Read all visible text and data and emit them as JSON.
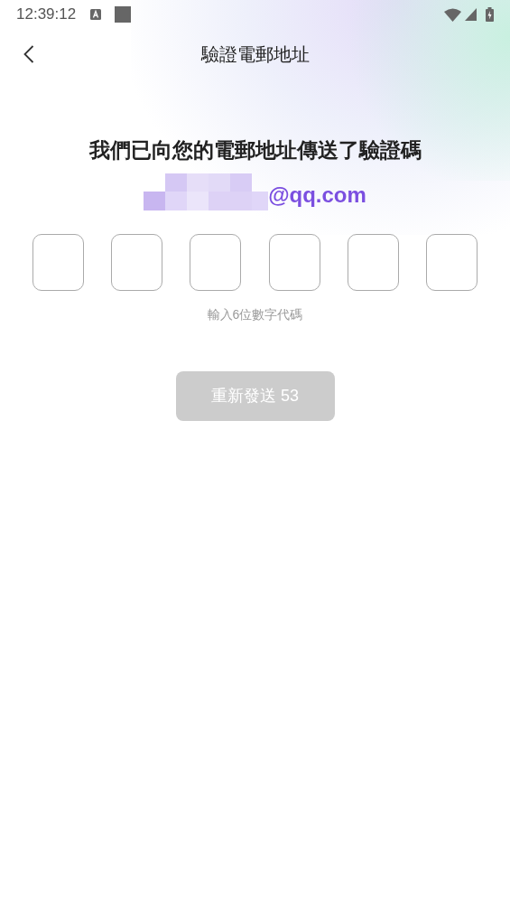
{
  "status_bar": {
    "time": "12:39:12"
  },
  "header": {
    "title": "驗證電郵地址"
  },
  "message": "我們已向您的電郵地址傳送了驗證碼",
  "email": {
    "visible_part": "@qq.com"
  },
  "code_boxes": [
    {
      "kind": "digit"
    },
    {
      "kind": "digit"
    },
    {
      "kind": "digit"
    },
    {
      "kind": "digit"
    },
    {
      "kind": "digit"
    },
    {
      "kind": "digit"
    }
  ],
  "hint": "輸入6位數字代碼",
  "resend_button": {
    "label": "重新發送 53",
    "disabled": true
  }
}
